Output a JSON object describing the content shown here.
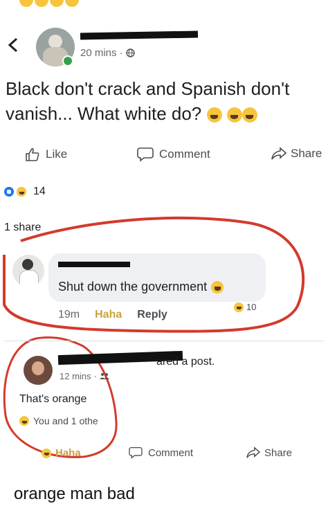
{
  "top_post": {
    "time": "20 mins",
    "body": "Black don't crack and Spanish don't vanish... What white do?",
    "actions": {
      "like": "Like",
      "comment": "Comment",
      "share": "Share"
    },
    "reaction_count": "14",
    "share_count": "1 share"
  },
  "comment": {
    "text": "Shut down the government",
    "time": "19m",
    "haha": "Haha",
    "reply": "Reply",
    "reaction_count": "10"
  },
  "shared_post": {
    "shared_text": "ared a post.",
    "time": "12 mins",
    "body": "That's orange",
    "reactions_text": "You and 1 othe",
    "haha_label": "Haha",
    "actions": {
      "comment": "Comment",
      "share": "Share"
    }
  },
  "caption": "orange man bad",
  "colors": {
    "accent": "#1877f2",
    "ink_red": "#d33a2c",
    "muted": "#65676b"
  }
}
